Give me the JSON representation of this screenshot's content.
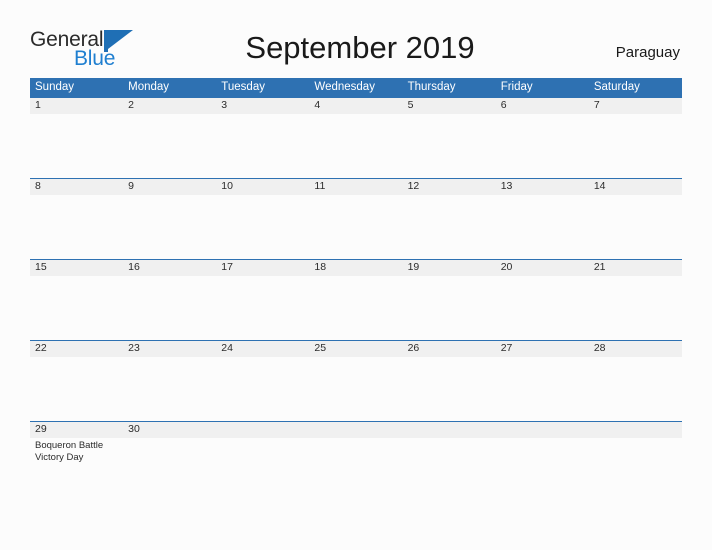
{
  "brand": {
    "name_part1": "General",
    "name_part2": "Blue",
    "flag_icon": "blue-flag-triangle-icon",
    "color_dark": "#2b2b2b",
    "color_blue": "#1f7fd0"
  },
  "header": {
    "title": "September 2019",
    "country": "Paraguay"
  },
  "theme": {
    "header_blue": "#2e71b2",
    "date_band_gray": "#f0f0f0",
    "page_background": "#fcfcfc",
    "text_dark": "#2b2b2b"
  },
  "calendar": {
    "month": "September",
    "year": "2019",
    "day_headers": [
      "Sunday",
      "Monday",
      "Tuesday",
      "Wednesday",
      "Thursday",
      "Friday",
      "Saturday"
    ],
    "weeks": [
      {
        "days": [
          {
            "num": "1",
            "event": ""
          },
          {
            "num": "2",
            "event": ""
          },
          {
            "num": "3",
            "event": ""
          },
          {
            "num": "4",
            "event": ""
          },
          {
            "num": "5",
            "event": ""
          },
          {
            "num": "6",
            "event": ""
          },
          {
            "num": "7",
            "event": ""
          }
        ]
      },
      {
        "days": [
          {
            "num": "8",
            "event": ""
          },
          {
            "num": "9",
            "event": ""
          },
          {
            "num": "10",
            "event": ""
          },
          {
            "num": "11",
            "event": ""
          },
          {
            "num": "12",
            "event": ""
          },
          {
            "num": "13",
            "event": ""
          },
          {
            "num": "14",
            "event": ""
          }
        ]
      },
      {
        "days": [
          {
            "num": "15",
            "event": ""
          },
          {
            "num": "16",
            "event": ""
          },
          {
            "num": "17",
            "event": ""
          },
          {
            "num": "18",
            "event": ""
          },
          {
            "num": "19",
            "event": ""
          },
          {
            "num": "20",
            "event": ""
          },
          {
            "num": "21",
            "event": ""
          }
        ]
      },
      {
        "days": [
          {
            "num": "22",
            "event": ""
          },
          {
            "num": "23",
            "event": ""
          },
          {
            "num": "24",
            "event": ""
          },
          {
            "num": "25",
            "event": ""
          },
          {
            "num": "26",
            "event": ""
          },
          {
            "num": "27",
            "event": ""
          },
          {
            "num": "28",
            "event": ""
          }
        ]
      },
      {
        "days": [
          {
            "num": "29",
            "event": "Boqueron Battle Victory Day"
          },
          {
            "num": "30",
            "event": ""
          },
          {
            "num": "",
            "event": ""
          },
          {
            "num": "",
            "event": ""
          },
          {
            "num": "",
            "event": ""
          },
          {
            "num": "",
            "event": ""
          },
          {
            "num": "",
            "event": ""
          }
        ]
      }
    ]
  }
}
